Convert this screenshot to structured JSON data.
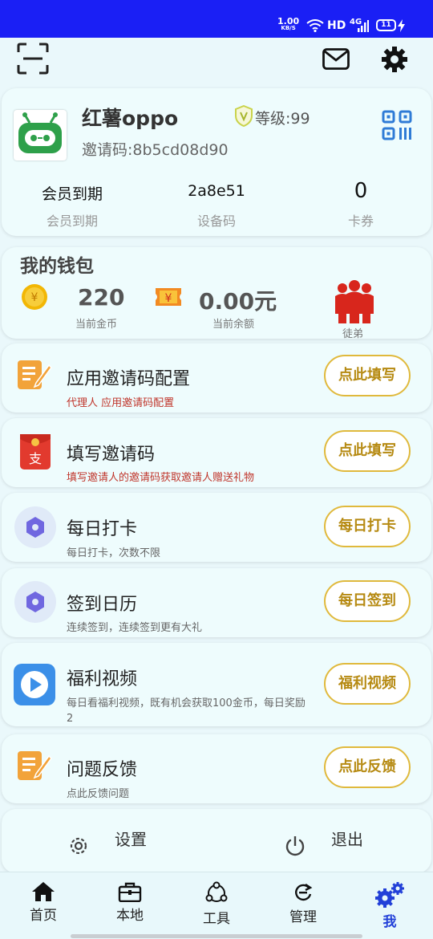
{
  "status_bar": {
    "speed_value": "1.00",
    "speed_unit": "KB/S",
    "network": "HD",
    "signal": "4G",
    "battery": "11"
  },
  "profile": {
    "username": "红薯oppo",
    "invite_code": "邀请码:8b5cd08d90",
    "level": "等级:99",
    "stats": [
      {
        "value": "会员到期",
        "label": "会员到期"
      },
      {
        "value": "2a8e51",
        "label": "设备码"
      },
      {
        "value": "0",
        "label": "卡券"
      }
    ]
  },
  "wallet": {
    "title": "我的钱包",
    "coins": "220",
    "coins_label": "当前金币",
    "balance": "0.00元",
    "balance_label": "当前余额",
    "apprentice_label": "徒弟"
  },
  "menu": [
    {
      "title": "应用邀请码配置",
      "subtitle": "代理人 应用邀请码配置",
      "button": "点此填写"
    },
    {
      "title": "填写邀请码",
      "subtitle": "填写邀请人的邀请码获取邀请人赠送礼物",
      "button": "点此填写"
    },
    {
      "title": "每日打卡",
      "subtitle": "每日打卡，次数不限",
      "button": "每日打卡"
    },
    {
      "title": "签到日历",
      "subtitle": "连续签到，连续签到更有大礼",
      "button": "每日签到"
    },
    {
      "title": "福利视频",
      "subtitle": "每日看福利视频，既有机会获取100金币，每日奖励2",
      "button": "福利视频"
    },
    {
      "title": "问题反馈",
      "subtitle": "点此反馈问题",
      "button": "点此反馈"
    }
  ],
  "footer": {
    "settings": "设置",
    "logout": "退出"
  },
  "nav": [
    {
      "label": "首页"
    },
    {
      "label": "本地"
    },
    {
      "label": "工具"
    },
    {
      "label": "管理"
    },
    {
      "label": "我"
    }
  ],
  "colors": {
    "accent": "#2240d8",
    "button_border": "#e0b93c",
    "status_bar": "#1a1ff5"
  }
}
